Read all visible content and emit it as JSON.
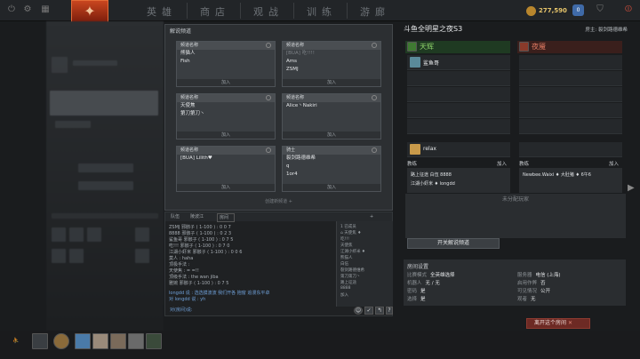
{
  "topbar": {
    "nav": [
      "英雄",
      "商店",
      "观战",
      "训练",
      "游廊"
    ],
    "gold": "277,590",
    "shards_badge": "0"
  },
  "broadcast": {
    "title": "解说频道",
    "create_label": "创建新频道",
    "slots": [
      {
        "header": "频道名称",
        "lines": [
          "熊猫人",
          "Fish"
        ],
        "join": "加入"
      },
      {
        "header": "频道名称",
        "lines": [
          "[BUA] 吃!!!!",
          "Ams",
          "ZSMJ"
        ],
        "join": "加入"
      },
      {
        "header": "频道名称",
        "lines": [
          "天使焦",
          "第刀第刀丶"
        ],
        "join": "加入"
      },
      {
        "header": "频道名称",
        "lines": [
          "Alice丶Nakiri"
        ],
        "join": "加入"
      },
      {
        "header": "频道名称",
        "lines": [
          "[BUA] Lilith♥"
        ],
        "join": "加入"
      },
      {
        "header": "骑士",
        "lines": [
          "裂剑路德维希",
          "q",
          "1or4"
        ],
        "join": "加入"
      }
    ]
  },
  "chat": {
    "tabs": [
      "队伍",
      "陵波江",
      "房间"
    ],
    "lines": [
      "ZSMJ 邪骸子 ( 1-100 ) : 0 0 7",
      "8888 邪骸子 ( 1-100 ) : 0 2 3",
      "鲨鱼哥 邪骸子 ( 1-100 ) : 0 7 5",
      "吃!!! 邪骸子 ( 1-100 ) : 0 7 0",
      "江湖小虾米 邪骸子 ( 1-100 ) : 0 0 6",
      "莫人 : haha",
      "顶极手法 :",
      "天使焦 : = =!!",
      "顶级手法 : the wan jiba",
      "雅婉 邪骸子 ( 1-100 ) : 0 7 5",
      "longdd 说 : 选选摸波波 我们开各 抱窗 追漫东平卓",
      "对 longdd 说 : yh"
    ],
    "input_label": "对(房间)说:",
    "members": [
      "1 已成员",
      "⌂ 天使焦 ♦",
      "吃!!!",
      "天使焦",
      "江湖小虾米 ♦",
      "熊猫人",
      "白伍",
      "裂剑路德维希",
      "第刀第刀丶",
      "路上征途",
      "8888",
      "加入"
    ]
  },
  "lobby": {
    "title": "斗鱼全明星之夜S3",
    "host": "房主: 裂剑路德维希",
    "radiant": {
      "name": "天辉",
      "color": "#6fbf4a",
      "players": [
        "鲨鱼哥",
        "",
        "",
        "",
        "",
        "relax"
      ]
    },
    "dire": {
      "name": "夜魇",
      "color": "#d4553f",
      "players": [
        "",
        "",
        "",
        "",
        "",
        ""
      ]
    },
    "radiant_coach": {
      "label": "教练",
      "join": "加入",
      "rows": [
        "路上征途    白伍    8888",
        "江湖小虾米 ♦  longdd"
      ]
    },
    "dire_coach": {
      "label": "教练",
      "join": "加入",
      "rows": [
        "Newbee.Waixi ♦ 大肚猪 ♦  6午6"
      ]
    },
    "unassigned": "未分配玩家",
    "broadcast_button": "开关解说频道",
    "settings": {
      "title": "房间设置",
      "items": [
        [
          "比赛模式",
          "全英雄选择"
        ],
        [
          "服务器",
          "电信 (上海)"
        ],
        [
          "机器人",
          "无 / 无"
        ],
        [
          "启用作弊",
          "否"
        ],
        [
          "密码",
          "是"
        ],
        [
          "可见情况",
          "公开"
        ],
        [
          "选择",
          "是"
        ],
        [
          "观者",
          "无"
        ]
      ]
    },
    "leave_button": "离开这个房间"
  }
}
